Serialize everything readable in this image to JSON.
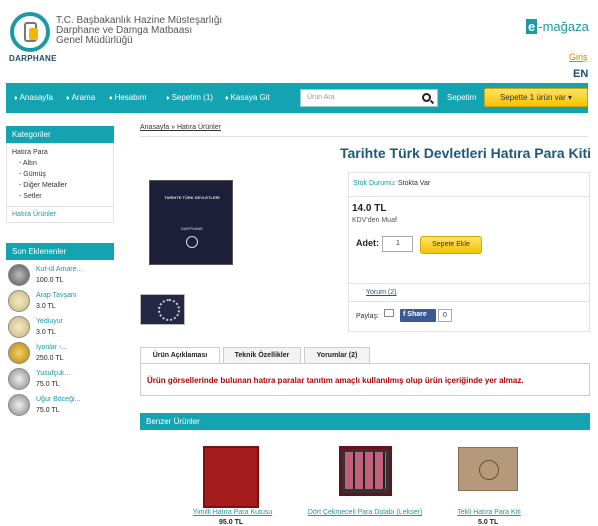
{
  "header": {
    "logo_text": "DARPHANE",
    "org_lines": [
      "T.C. Başbakanlık Hazine Müsteşarlığı",
      "Darphane ve Damga Matbaası",
      "Genel Müdürlüğü"
    ],
    "emagaza_e": "e",
    "emagaza_rest": "-mağaza",
    "login_link": "Giriş",
    "language": "EN"
  },
  "nav": {
    "items": [
      "Anasayfa",
      "Arama",
      "Hesabım",
      "Sepetim (1)",
      "Kasaya Git"
    ],
    "bullet": "♦",
    "search_placeholder": "Ürün Ara",
    "cart_label": "Sepetim",
    "cart_button": "Sepette 1 ürün var ▾"
  },
  "sidebar": {
    "categories_title": "Kategoriler",
    "root_category": "Hatıra Para",
    "sub_categories": [
      "- Altın",
      "- Gümüş",
      "- Diğer Metaller",
      "- Setler"
    ],
    "other_category": "Hatıra Ürünler",
    "recent_title": "Son Eklenenler",
    "recent_items": [
      {
        "name": "Kut-ül Amare...",
        "price": "100.0 TL"
      },
      {
        "name": "Arap Tavşanı",
        "price": "3.0 TL"
      },
      {
        "name": "Yediuyur",
        "price": "3.0 TL"
      },
      {
        "name": "İyonlar -...",
        "price": "250.0 TL"
      },
      {
        "name": "Yusufçuk...",
        "price": "75.0 TL"
      },
      {
        "name": "Uğur Böceği...",
        "price": "75.0 TL"
      }
    ]
  },
  "breadcrumb": {
    "home": "Anasayfa",
    "sep": " » ",
    "current": "Hatıra Ürünler"
  },
  "product": {
    "title": "Tarihte Türk Devletleri Hatıra Para Kiti",
    "image_title": "TARİHTE TÜRK DEVLETLERİ",
    "image_brand": "DARPHANE",
    "stock_label": "Stok Durumu:",
    "stock_value": "Stokta Var",
    "price": "14.0 TL",
    "vat_note": "KDV'den Muaf",
    "qty_label": "Adet:",
    "qty_value": "1",
    "add_to_cart": "Sepete Ekle",
    "reviews_link": "Yorum (2)",
    "share_label": "Paylaş:",
    "fb_label": "Share",
    "fb_count": "0"
  },
  "tabs": {
    "items": [
      "Ürün Açıklaması",
      "Teknik Özellikler",
      "Yorumlar (2)"
    ],
    "notice": "Ürün görsellerinde bulunan hatıra paralar tanıtım amaçlı kullanılmış olup ürün içeriğinde yer almaz."
  },
  "similar": {
    "title": "Benzer Ürünler",
    "items": [
      {
        "name": "Yimilli Hatıra Para Kutusu",
        "price": "95.0 TL"
      },
      {
        "name": "Dört Çekmeceli Para Dolabı (Lekser)",
        "price": ""
      },
      {
        "name": "Tekli Hatıra Para Kiti",
        "price": "5.0 TL"
      }
    ]
  },
  "colors": {
    "accent": "#14a3b0",
    "title": "#1e5a78",
    "button": "#f5c300",
    "notice": "#b40000"
  }
}
